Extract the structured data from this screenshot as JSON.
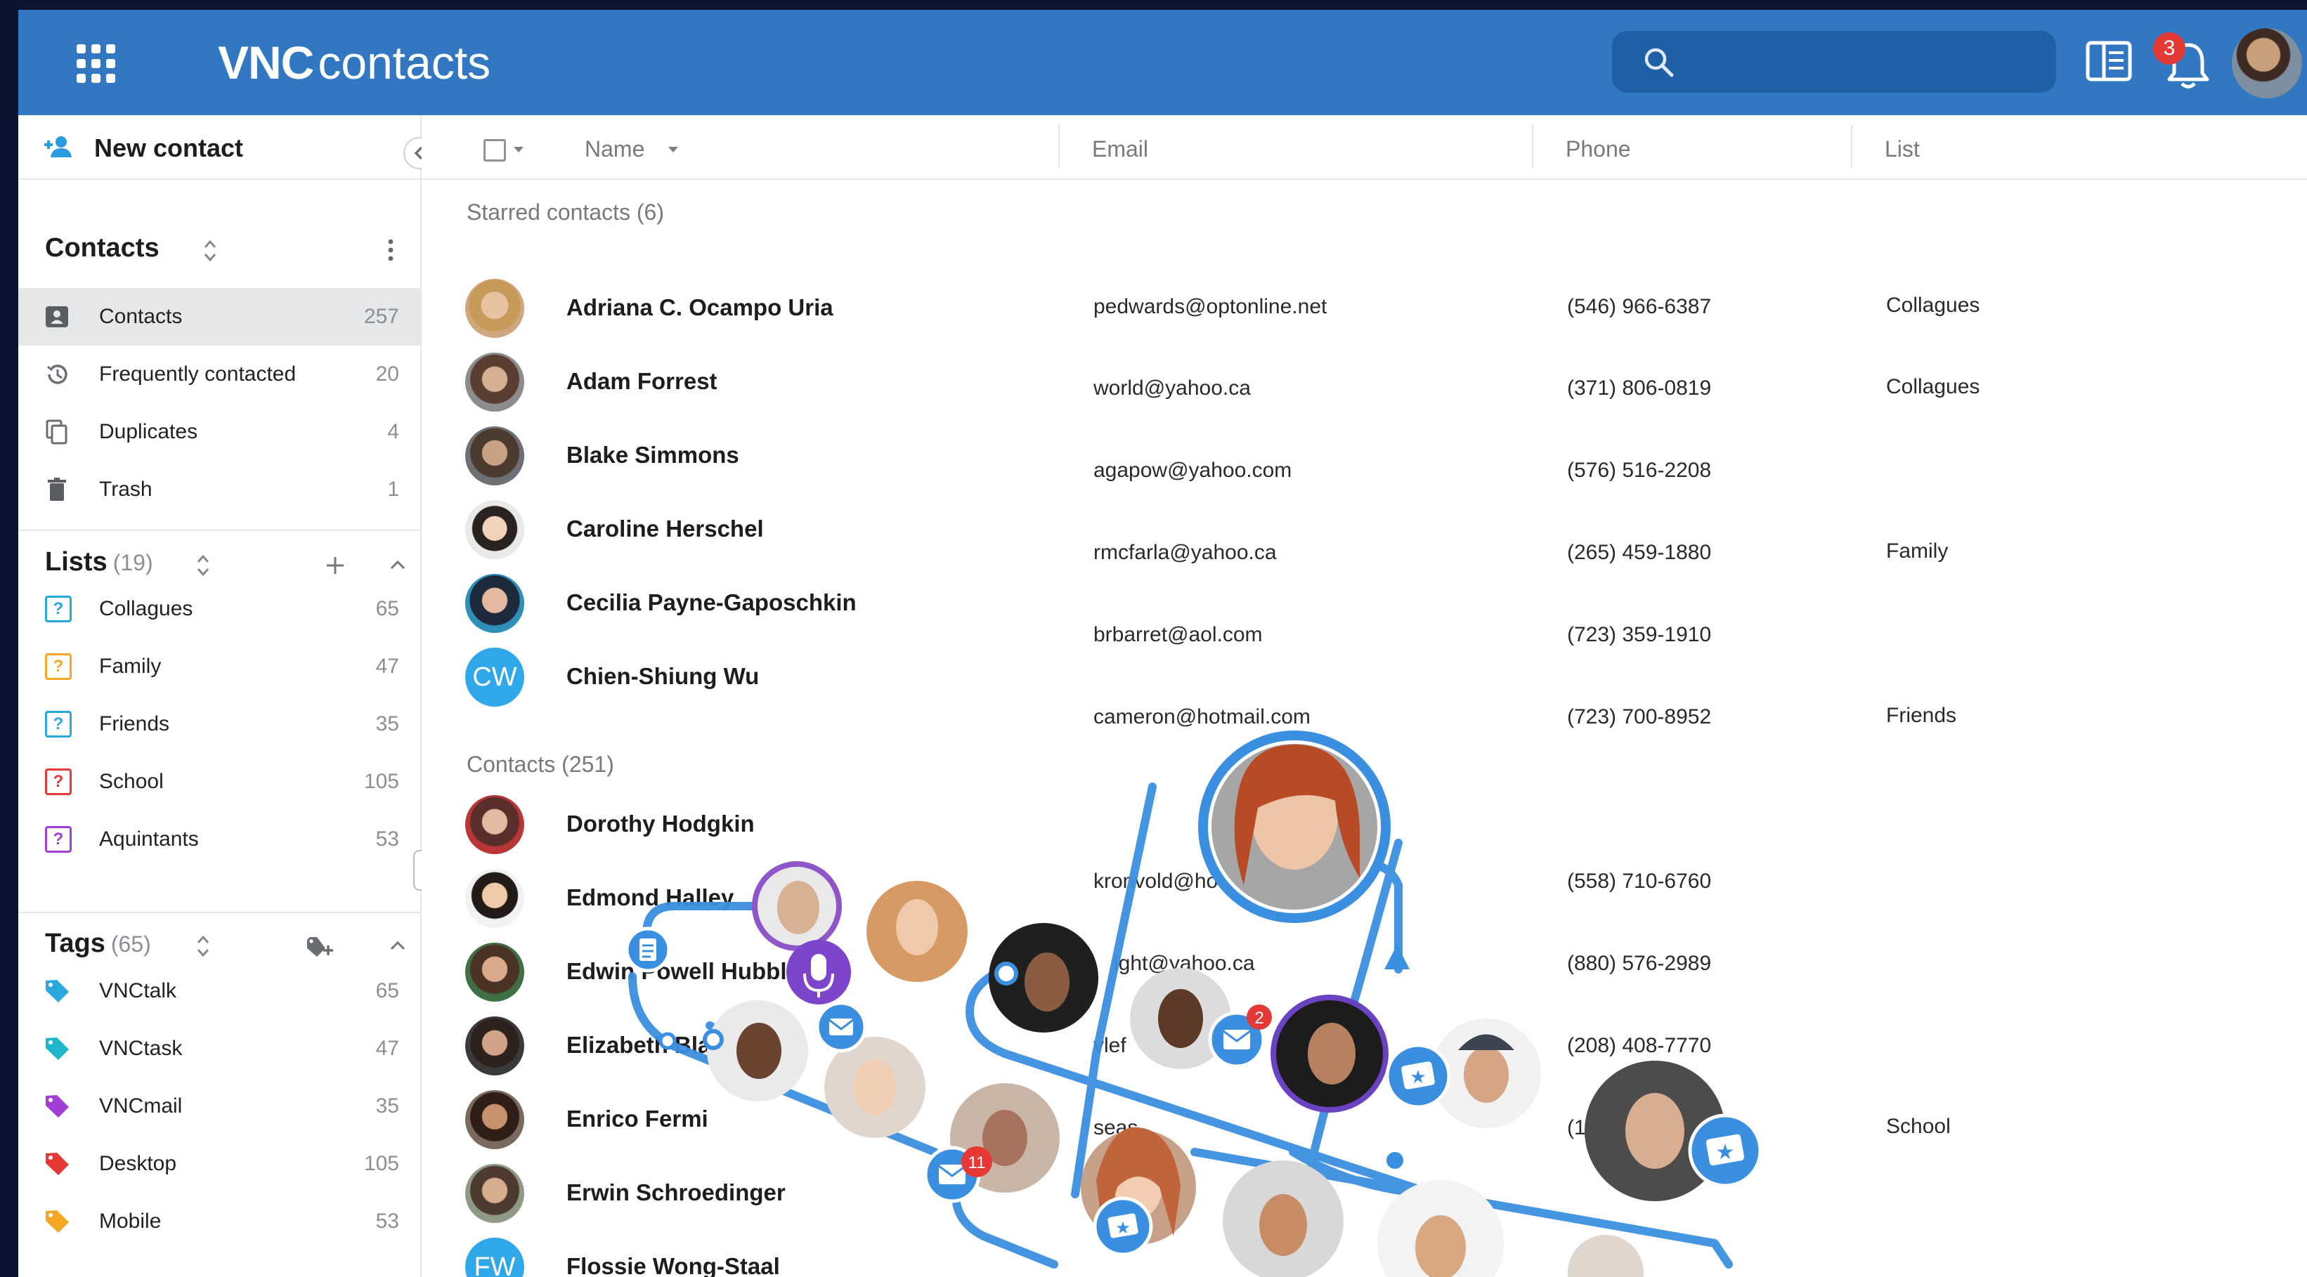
{
  "app": {
    "brand_bold": "VNC",
    "brand_rest": "contacts",
    "notification_count": "3"
  },
  "sidebar": {
    "new_contact_label": "New contact",
    "contacts_title": "Contacts",
    "contact_items": [
      {
        "label": "Contacts",
        "count": "257"
      },
      {
        "label": "Frequently contacted",
        "count": "20"
      },
      {
        "label": "Duplicates",
        "count": "4"
      },
      {
        "label": "Trash",
        "count": "1"
      }
    ],
    "lists_title": "Lists",
    "lists_count": "(19)",
    "lists": [
      {
        "label": "Collagues",
        "count": "65",
        "color": "#29a8e0"
      },
      {
        "label": "Family",
        "count": "47",
        "color": "#f5a623"
      },
      {
        "label": "Friends",
        "count": "35",
        "color": "#29a8e0"
      },
      {
        "label": "School",
        "count": "105",
        "color": "#e53935"
      },
      {
        "label": "Aquintants",
        "count": "53",
        "color": "#a23dd6"
      }
    ],
    "tags_title": "Tags",
    "tags_count": "(65)",
    "tags": [
      {
        "label": "VNCtalk",
        "count": "65",
        "color": "#29a8e0"
      },
      {
        "label": "VNCtask",
        "count": "47",
        "color": "#1fb6c9"
      },
      {
        "label": "VNCmail",
        "count": "35",
        "color": "#a23dd6"
      },
      {
        "label": "Desktop",
        "count": "105",
        "color": "#e53935"
      },
      {
        "label": "Mobile",
        "count": "53",
        "color": "#f5a623"
      }
    ]
  },
  "table": {
    "headers": {
      "name": "Name",
      "email": "Email",
      "phone": "Phone",
      "list": "List"
    },
    "starred_label": "Starred contacts (6)",
    "contacts_label": "Contacts (251)",
    "starred": [
      {
        "name": "Adriana C. Ocampo Uria",
        "initials": ""
      },
      {
        "name": "Adam Forrest",
        "initials": ""
      },
      {
        "name": "Blake Simmons",
        "initials": ""
      },
      {
        "name": "Caroline Herschel",
        "initials": ""
      },
      {
        "name": "Cecilia Payne-Gaposchkin",
        "initials": ""
      },
      {
        "name": "Chien-Shiung Wu",
        "initials": "CW"
      }
    ],
    "contacts": [
      {
        "name": "Dorothy Hodgkin",
        "initials": ""
      },
      {
        "name": "Edmond Halley",
        "initials": ""
      },
      {
        "name": "Edwin Powell Hubble",
        "initials": ""
      },
      {
        "name": "Elizabeth Blackwell",
        "initials": ""
      },
      {
        "name": "Enrico Fermi",
        "initials": ""
      },
      {
        "name": "Erwin Schroedinger",
        "initials": ""
      },
      {
        "name": "Flossie Wong-Staal",
        "initials": "FW"
      }
    ],
    "details": [
      {
        "email": "pedwards@optonline.net",
        "phone": "(546) 966-6387",
        "list": "Collagues"
      },
      {
        "email": "world@yahoo.ca",
        "phone": "(371) 806-0819",
        "list": "Collagues"
      },
      {
        "email": "agapow@yahoo.com",
        "phone": "(576) 516-2208",
        "list": ""
      },
      {
        "email": "rmcfarla@yahoo.ca",
        "phone": "(265) 459-1880",
        "list": "Family"
      },
      {
        "email": "brbarret@aol.com",
        "phone": "(723) 359-1910",
        "list": ""
      },
      {
        "email": "cameron@hotmail.com",
        "phone": "(723) 700-8952",
        "list": "Friends"
      },
      {
        "email": "kronvold@ho",
        "phone": "(558) 710-6760",
        "list": ""
      },
      {
        "email": "ight@yahoo.ca",
        "phone": "(880) 576-2989",
        "list": ""
      },
      {
        "email": "vlef",
        "phone": "(208) 408-7770",
        "list": ""
      },
      {
        "email": "seas",
        "phone": "(126",
        "list": "School"
      }
    ]
  },
  "overlay": {
    "badge_mail_1": "2",
    "badge_mail_2": "11"
  }
}
